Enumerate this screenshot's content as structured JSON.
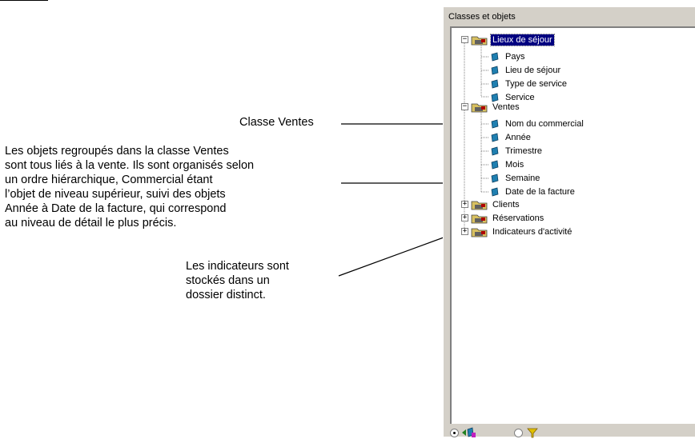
{
  "annotations": {
    "ventes_class": "Classe Ventes",
    "objets_text": "Les objets regroupés dans la classe Ventes\nsont tous liés à la vente. Ils sont organisés selon\nun ordre hiérarchique, Commercial étant\nl’objet de niveau supérieur, suivi des objets\nAnnée à Date de la facture, qui correspond\nau niveau de détail le plus précis.",
    "indicateurs_text": "Les indicateurs sont\nstockés dans un\ndossier distinct."
  },
  "panel": {
    "title": "Classes et objets",
    "tree": {
      "lieux": {
        "label": "Lieux de séjour",
        "expanded": true,
        "items": [
          "Pays",
          "Lieu de séjour",
          "Type de service",
          "Service"
        ]
      },
      "ventes": {
        "label": "Ventes",
        "expanded": true,
        "items": [
          "Nom du commercial",
          "Année",
          "Trimestre",
          "Mois",
          "Semaine",
          "Date de la facture"
        ]
      },
      "clients": {
        "label": "Clients",
        "expanded": false
      },
      "reservations": {
        "label": "Réservations",
        "expanded": false
      },
      "indicateurs": {
        "label": "Indicateurs d'activité",
        "expanded": false
      }
    },
    "footer": {
      "objects_view_selected": true,
      "filters_view_selected": false
    }
  },
  "colors": {
    "panel_bg": "#d4d0c8",
    "selection": "#000080",
    "object_icon": "#1f7fb0",
    "filter_icon": "#e0c000"
  }
}
